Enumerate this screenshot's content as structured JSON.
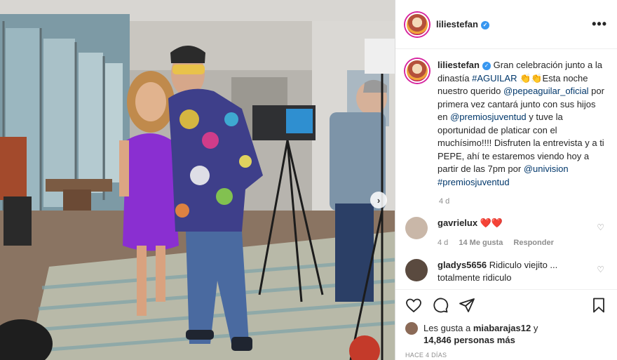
{
  "header": {
    "username": "liliestefan",
    "more_label": "•••"
  },
  "caption": {
    "username": "liliestefan",
    "part1": "Gran celebración junto a la dinastía ",
    "hashtag1": "#AGUILAR",
    "emojis": " 👏👏",
    "part2": "Esta noche nuestro querido ",
    "mention1": "@pepeaguilar_oficial",
    "part3": " por primera vez cantará junto con sus hijos en ",
    "mention2": "@premiosjuventud",
    "part4": " y tuve la oportunidad de platicar con el muchísimo!!!! Disfruten la entrevista y a ti PEPE, ahí te estaremos viendo hoy a partir de las 7pm por ",
    "mention3": "@univision",
    "hashtag2": "#premiosjuventud",
    "time": "4 d"
  },
  "comments": [
    {
      "username": "gavrielux",
      "text": "❤️❤️",
      "time": "4 d",
      "likes": "14 Me gusta",
      "reply": "Responder",
      "avatar_color": "#c9b7a8"
    },
    {
      "username": "gladys5656",
      "text": "Ridiculo viejito ... totalmente ridiculo",
      "avatar_color": "#5a4a3f"
    }
  ],
  "likes": {
    "prefix": "Les gusta a ",
    "user": "miabarajas12",
    "middle": " y",
    "count": "14,846 personas más"
  },
  "date": "HACE 4 DÍAS",
  "colors": {
    "verified": "#3897f0",
    "link": "#00376b",
    "heart": "#ed4956"
  }
}
